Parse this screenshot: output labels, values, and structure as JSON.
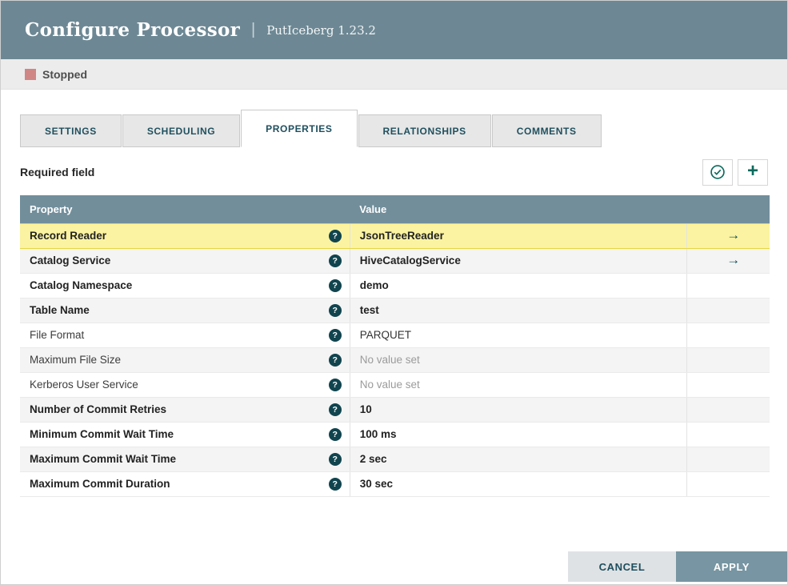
{
  "header": {
    "title": "Configure Processor",
    "separator": "|",
    "subtitle": "PutIceberg 1.23.2"
  },
  "status": {
    "label": "Stopped",
    "color": "#d18686"
  },
  "tabs": [
    {
      "label": "SETTINGS",
      "active": false
    },
    {
      "label": "SCHEDULING",
      "active": false
    },
    {
      "label": "PROPERTIES",
      "active": true
    },
    {
      "label": "RELATIONSHIPS",
      "active": false
    },
    {
      "label": "COMMENTS",
      "active": false
    }
  ],
  "toolbar": {
    "required_label": "Required field",
    "verify_icon": "check-circle",
    "add_icon": "plus"
  },
  "icons": {
    "help_glyph": "?",
    "go_to_glyph": "→",
    "plus_glyph": "+"
  },
  "table": {
    "columns": [
      "Property",
      "Value"
    ],
    "rows": [
      {
        "property": "Record Reader",
        "value": "JsonTreeReader",
        "required": true,
        "value_bold": true,
        "unset": false,
        "has_arrow": true,
        "selected": true
      },
      {
        "property": "Catalog Service",
        "value": "HiveCatalogService",
        "required": true,
        "value_bold": true,
        "unset": false,
        "has_arrow": true,
        "selected": false
      },
      {
        "property": "Catalog Namespace",
        "value": "demo",
        "required": true,
        "value_bold": true,
        "unset": false,
        "has_arrow": false,
        "selected": false
      },
      {
        "property": "Table Name",
        "value": "test",
        "required": true,
        "value_bold": true,
        "unset": false,
        "has_arrow": false,
        "selected": false
      },
      {
        "property": "File Format",
        "value": "PARQUET",
        "required": false,
        "value_bold": false,
        "unset": false,
        "has_arrow": false,
        "selected": false
      },
      {
        "property": "Maximum File Size",
        "value": "No value set",
        "required": false,
        "value_bold": false,
        "unset": true,
        "has_arrow": false,
        "selected": false
      },
      {
        "property": "Kerberos User Service",
        "value": "No value set",
        "required": false,
        "value_bold": false,
        "unset": true,
        "has_arrow": false,
        "selected": false
      },
      {
        "property": "Number of Commit Retries",
        "value": "10",
        "required": true,
        "value_bold": true,
        "unset": false,
        "has_arrow": false,
        "selected": false
      },
      {
        "property": "Minimum Commit Wait Time",
        "value": "100 ms",
        "required": true,
        "value_bold": true,
        "unset": false,
        "has_arrow": false,
        "selected": false
      },
      {
        "property": "Maximum Commit Wait Time",
        "value": "2 sec",
        "required": true,
        "value_bold": true,
        "unset": false,
        "has_arrow": false,
        "selected": false
      },
      {
        "property": "Maximum Commit Duration",
        "value": "30 sec",
        "required": true,
        "value_bold": true,
        "unset": false,
        "has_arrow": false,
        "selected": false
      }
    ]
  },
  "footer": {
    "cancel_label": "CANCEL",
    "apply_label": "APPLY"
  },
  "colors": {
    "header_bg": "#6d8894",
    "table_header_bg": "#728e9b",
    "selected_row_bg": "#fbf3a1",
    "accent_teal": "#0b6a5d",
    "apply_bg": "#7795a2"
  }
}
